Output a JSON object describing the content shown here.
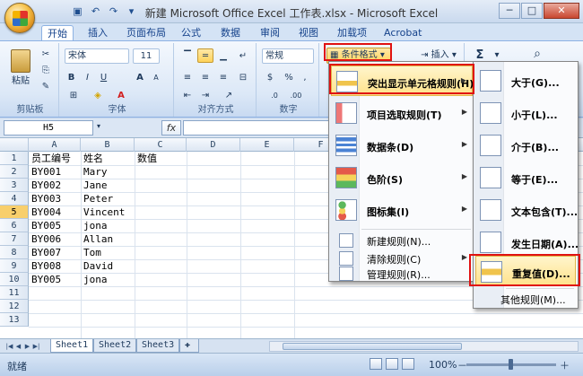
{
  "window": {
    "title": "新建 Microsoft Office Excel 工作表.xlsx - Microsoft Excel",
    "min": "─",
    "max": "□",
    "close": "✕"
  },
  "qat": [
    "save-icon",
    "undo-icon",
    "redo-icon"
  ],
  "tabs": [
    "开始",
    "插入",
    "页面布局",
    "公式",
    "数据",
    "审阅",
    "视图",
    "加载项",
    "Acrobat"
  ],
  "ribbon": {
    "clipboard": {
      "label": "剪贴板",
      "paste": "粘贴"
    },
    "font": {
      "label": "字体",
      "name": "宋体",
      "size": "11",
      "bold": "B",
      "italic": "I",
      "underline": "U",
      "grow": "A",
      "shrink": "A"
    },
    "alignment": {
      "label": "对齐方式"
    },
    "number": {
      "label": "数字",
      "format": "常规",
      "percent": "%",
      "comma": ","
    },
    "styles": {
      "conditional_format": "条件格式"
    },
    "cells": {
      "insert": "插入"
    },
    "editing": {
      "sum": "Σ"
    }
  },
  "formula_bar": {
    "name_box": "H5",
    "fx": "fx"
  },
  "columns": [
    "A",
    "B",
    "C",
    "D",
    "E",
    "F"
  ],
  "rows": [
    "1",
    "2",
    "3",
    "4",
    "5",
    "6",
    "7",
    "8",
    "9",
    "10",
    "11",
    "12",
    "13"
  ],
  "cells": [
    [
      "员工编号",
      "姓名",
      "数值"
    ],
    [
      "BY001",
      "Mary"
    ],
    [
      "BY002",
      "Jane"
    ],
    [
      "BY003",
      "Peter"
    ],
    [
      "BY004",
      "Vincent"
    ],
    [
      "BY005",
      "jona"
    ],
    [
      "BY006",
      "Allan"
    ],
    [
      "BY007",
      "Tom"
    ],
    [
      "BY008",
      "David"
    ],
    [
      "BY005",
      "jona"
    ]
  ],
  "sheets": [
    "Sheet1",
    "Sheet2",
    "Sheet3"
  ],
  "status": {
    "ready": "就绪",
    "zoom": "100%",
    "minus": "－",
    "plus": "＋"
  },
  "menu_main": [
    {
      "label": "突出显示单元格规则(H)",
      "icon": "highlight-rules-icon"
    },
    {
      "label": "项目选取规则(T)",
      "icon": "top-bottom-rules-icon"
    },
    {
      "label": "数据条(D)",
      "icon": "data-bars-icon"
    },
    {
      "label": "色阶(S)",
      "icon": "color-scales-icon"
    },
    {
      "label": "图标集(I)",
      "icon": "icon-sets-icon"
    }
  ],
  "menu_main_small": [
    "新建规则(N)...",
    "清除规则(C)",
    "管理规则(R)..."
  ],
  "menu_sub": [
    "大于(G)...",
    "小于(L)...",
    "介于(B)...",
    "等于(E)...",
    "文本包含(T)...",
    "发生日期(A)...",
    "重复值(D)..."
  ],
  "menu_sub_more": "其他规则(M)...",
  "colors": {
    "accent_red": "#e01212",
    "highlight": "#ffe28b"
  }
}
